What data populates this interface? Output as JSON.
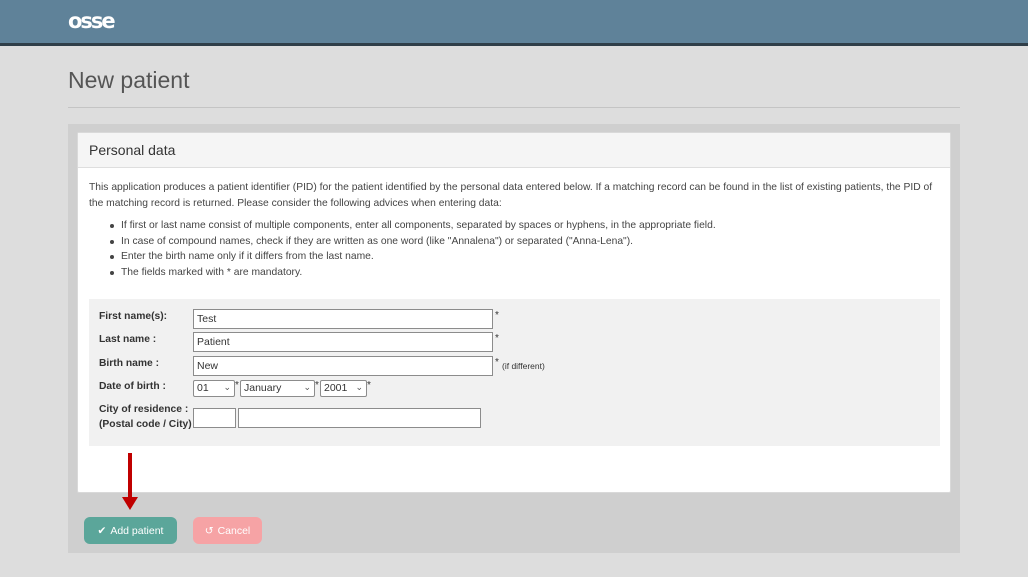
{
  "header": {
    "logo": "osse"
  },
  "page": {
    "title": "New patient"
  },
  "panel": {
    "title": "Personal data",
    "intro": "This application produces a patient identifier (PID) for the patient identified by the personal data entered below. If a matching record can be found in the list of existing patients, the PID of the matching record is returned. Please consider the following advices when entering data:",
    "bullets": [
      "If first or last name consist of multiple components, enter all components, separated by spaces or hyphens, in the appropriate field.",
      "In case of compound names, check if they are written as one word (like \"Annalena\") or separated (\"Anna-Lena\").",
      "Enter the birth name only if it differs from the last name.",
      "The fields marked with * are mandatory."
    ]
  },
  "form": {
    "first_name": {
      "label": "First name(s):",
      "value": "Test",
      "marker": "*"
    },
    "last_name": {
      "label": "Last name :",
      "value": "Patient",
      "marker": "*"
    },
    "birth_name": {
      "label": "Birth name :",
      "value": "New",
      "marker": "*",
      "note": "(if different)"
    },
    "dob": {
      "label": "Date of birth :",
      "day": "01",
      "month": "January",
      "year": "2001",
      "marker": "*"
    },
    "city": {
      "label_line1": "City of residence :",
      "label_line2": "(Postal code / City)",
      "postal": "",
      "city": ""
    }
  },
  "buttons": {
    "add": "Add patient",
    "cancel": "Cancel"
  },
  "colors": {
    "header": "#5f8299",
    "add": "#5ba69a",
    "cancel": "#f6a3a5",
    "arrow": "#c00000"
  }
}
